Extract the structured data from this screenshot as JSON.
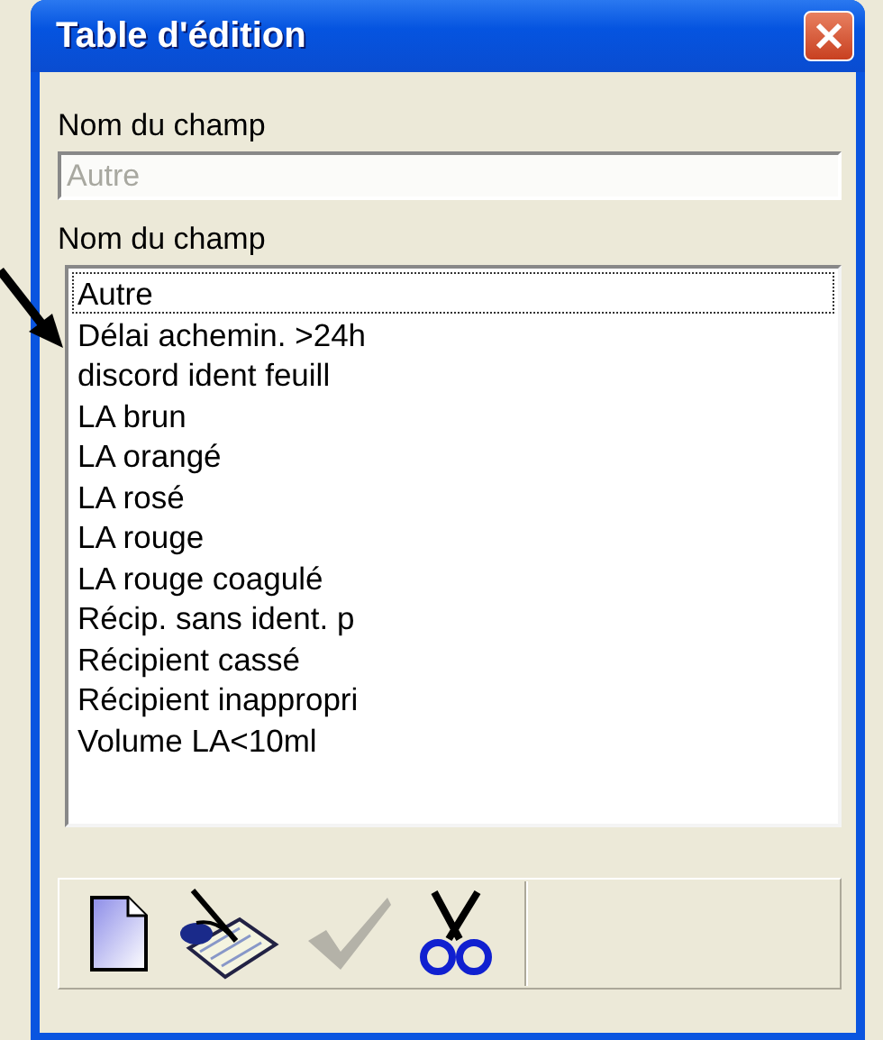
{
  "window": {
    "title": "Table d'édition"
  },
  "field": {
    "label": "Nom du champ",
    "value": "Autre",
    "disabled": true
  },
  "list": {
    "label": "Nom du champ",
    "items": [
      {
        "label": "Autre",
        "focused": true
      },
      {
        "label": "Délai achemin. >24h",
        "focused": false
      },
      {
        "label": "discord ident feuill",
        "focused": false
      },
      {
        "label": "LA brun",
        "focused": false
      },
      {
        "label": "LA orangé",
        "focused": false
      },
      {
        "label": "LA rosé",
        "focused": false
      },
      {
        "label": "LA rouge",
        "focused": false
      },
      {
        "label": "LA rouge coagulé",
        "focused": false
      },
      {
        "label": "Récip. sans ident. p",
        "focused": false
      },
      {
        "label": "Récipient cassé",
        "focused": false
      },
      {
        "label": "Récipient inappropri",
        "focused": false
      },
      {
        "label": "Volume LA<10ml",
        "focused": false
      }
    ]
  },
  "toolbar": [
    {
      "kind": "new",
      "disabled": false
    },
    {
      "kind": "edit",
      "disabled": false
    },
    {
      "kind": "validate",
      "disabled": true
    },
    {
      "kind": "cut",
      "disabled": false
    }
  ]
}
